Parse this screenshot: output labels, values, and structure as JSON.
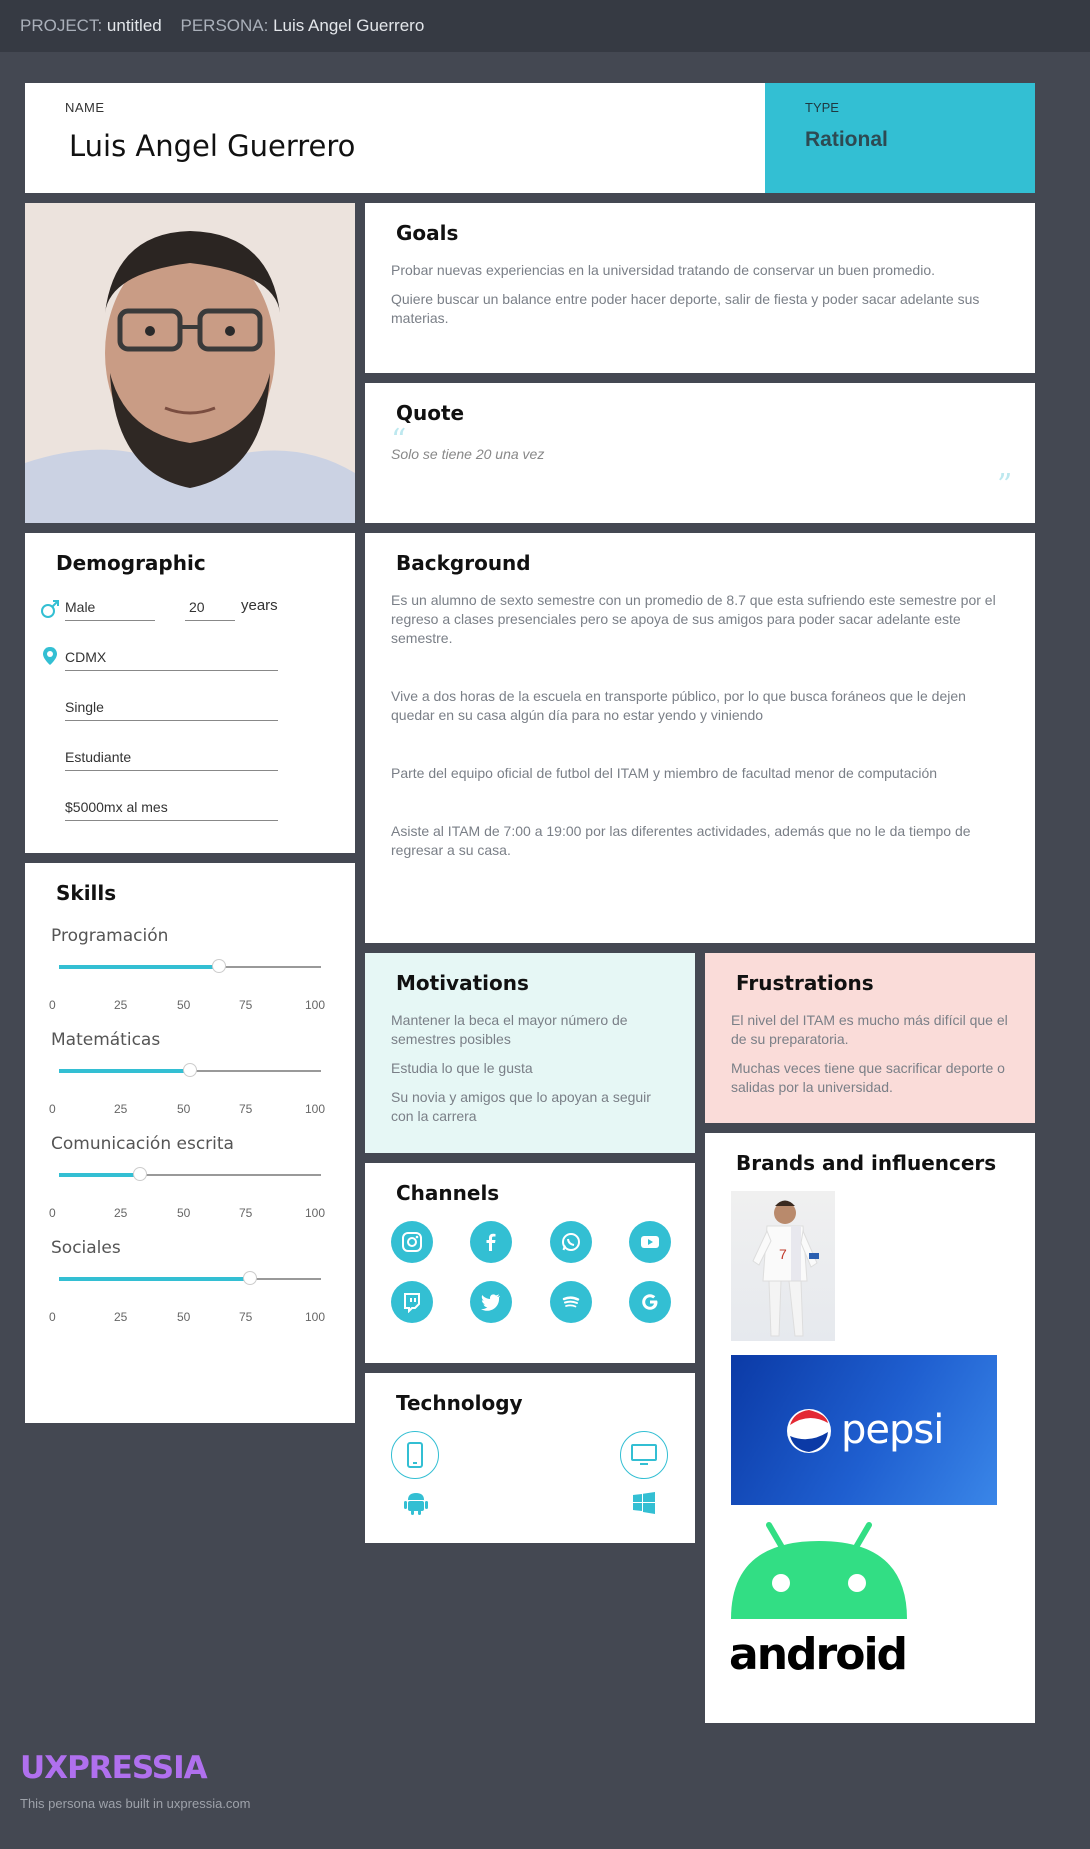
{
  "topbar": {
    "project_label": "PROJECT:",
    "project_value": "untitled",
    "persona_label": "PERSONA:",
    "persona_value": "Luis Angel Guerrero"
  },
  "persona": {
    "name_label": "NAME",
    "name": "Luis Angel Guerrero",
    "type_label": "TYPE",
    "type": "Rational"
  },
  "goals": {
    "title": "Goals",
    "items": [
      "Probar nuevas experiencias en la universidad tratando de conservar un buen promedio.",
      "Quiere buscar un balance entre poder hacer deporte, salir de fiesta y poder sacar adelante sus materias."
    ]
  },
  "quote": {
    "title": "Quote",
    "text": "Solo se tiene 20 una vez"
  },
  "demographic": {
    "title": "Demographic",
    "gender": "Male",
    "age": "20",
    "age_unit": "years",
    "location": "CDMX",
    "status": "Single",
    "occupation": "Estudiante",
    "income": "$5000mx al mes"
  },
  "background": {
    "title": "Background",
    "items": [
      "Es un alumno de sexto semestre con un promedio de 8.7 que esta sufriendo este semestre por el regreso a clases presenciales pero se apoya de sus amigos para poder sacar adelante este semestre.",
      "Vive a dos horas de la escuela en transporte público, por lo que busca foráneos que le dejen quedar en su casa algún día para no estar yendo y viniendo",
      "Parte del equipo oficial de futbol del ITAM y miembro de facultad menor de computación",
      "Asiste al ITAM de 7:00 a 19:00 por las diferentes actividades, además que no le da tiempo de regresar a su casa."
    ]
  },
  "skills": {
    "title": "Skills",
    "ticks": [
      "0",
      "25",
      "50",
      "75",
      "100"
    ],
    "items": [
      {
        "label": "Programación",
        "value": 61
      },
      {
        "label": "Matemáticas",
        "value": 50
      },
      {
        "label": "Comunicación escrita",
        "value": 31
      },
      {
        "label": "Sociales",
        "value": 73
      }
    ]
  },
  "motivations": {
    "title": "Motivations",
    "items": [
      "Mantener la beca el mayor número de semestres posibles",
      "Estudia lo que le gusta",
      "Su novia y amigos que lo apoyan a seguir con la carrera"
    ]
  },
  "frustrations": {
    "title": "Frustrations",
    "items": [
      "El nivel del ITAM es mucho más difícil que el de su preparatoria.",
      "Muchas veces tiene que sacrificar deporte o salidas por la universidad."
    ]
  },
  "channels": {
    "title": "Channels",
    "icons": [
      "instagram-icon",
      "facebook-icon",
      "whatsapp-icon",
      "youtube-icon",
      "twitch-icon",
      "twitter-icon",
      "spotify-icon",
      "google-icon"
    ]
  },
  "brands": {
    "title": "Brands and influencers",
    "pepsi_text": "pepsi",
    "android_text": "android"
  },
  "technology": {
    "title": "Technology",
    "icons": [
      "mobile-icon",
      "desktop-icon",
      "android-icon",
      "windows-icon"
    ]
  },
  "footer": {
    "brand": "UXPRESSIA",
    "text": "This persona was built in uxpressia.com"
  },
  "colors": {
    "accent": "#33bfd3",
    "background": "#444852",
    "motivations_bg": "#e6f7f5",
    "frustrations_bg": "#fadcd9",
    "brand": "#b070ee"
  }
}
